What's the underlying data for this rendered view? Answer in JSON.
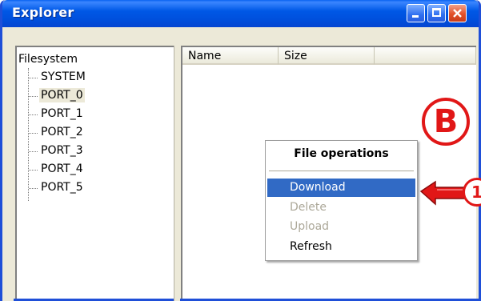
{
  "window": {
    "title": "Explorer"
  },
  "tree": {
    "root_label": "Filesystem",
    "items": [
      {
        "label": "SYSTEM",
        "selected": false
      },
      {
        "label": "PORT_0",
        "selected": true
      },
      {
        "label": "PORT_1",
        "selected": false
      },
      {
        "label": "PORT_2",
        "selected": false
      },
      {
        "label": "PORT_3",
        "selected": false
      },
      {
        "label": "PORT_4",
        "selected": false
      },
      {
        "label": "PORT_5",
        "selected": false
      }
    ]
  },
  "list": {
    "columns": [
      "Name",
      "Size"
    ]
  },
  "context_menu": {
    "title": "File operations",
    "items": [
      {
        "label": "Download",
        "state": "highlighted"
      },
      {
        "label": "Delete",
        "state": "disabled"
      },
      {
        "label": "Upload",
        "state": "disabled"
      },
      {
        "label": "Refresh",
        "state": "enabled"
      }
    ]
  },
  "annotations": {
    "marker_b": "B",
    "marker_1": "1",
    "color": "#e11717"
  },
  "colors": {
    "titlebar": "#0058e6",
    "window_face": "#ece9d8",
    "highlight": "#316ac5"
  }
}
